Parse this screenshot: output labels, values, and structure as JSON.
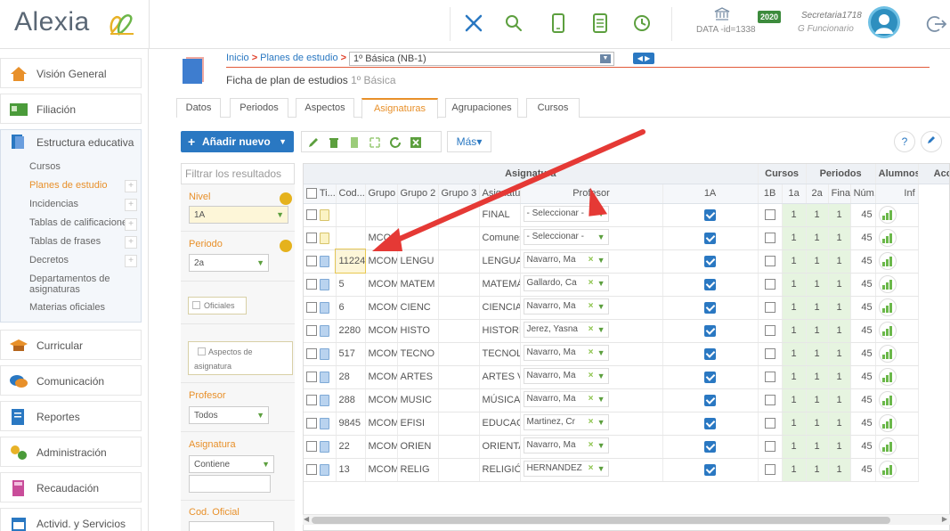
{
  "app": {
    "name": "Alexia"
  },
  "topbar": {
    "data_label": "DATA -id=1338",
    "year": "2020",
    "user_name": "Secretaria1718",
    "user_role": "Funcionario"
  },
  "sidebar": {
    "items": [
      {
        "label": "Visión General",
        "icon": "home-icon"
      },
      {
        "label": "Filiación",
        "icon": "id-card-icon"
      },
      {
        "label": "Estructura educativa",
        "icon": "books-icon"
      },
      {
        "label": "Curricular",
        "icon": "graduation-cap-icon"
      },
      {
        "label": "Comunicación",
        "icon": "chat-bubbles-icon"
      },
      {
        "label": "Reportes",
        "icon": "report-icon"
      },
      {
        "label": "Administración",
        "icon": "gears-icon"
      },
      {
        "label": "Recaudación",
        "icon": "calculator-icon"
      },
      {
        "label": "Activid. y Servicios",
        "icon": "calendar-icon"
      }
    ],
    "subitems": [
      {
        "label": "Cursos",
        "plus": false
      },
      {
        "label": "Planes de estudio",
        "plus": true
      },
      {
        "label": "Incidencias",
        "plus": true
      },
      {
        "label": "Tablas de calificaciones",
        "plus": true
      },
      {
        "label": "Tablas de frases",
        "plus": true
      },
      {
        "label": "Decretos",
        "plus": true
      },
      {
        "label": "Departamentos de asignaturas",
        "plus": false
      },
      {
        "label": "Materias oficiales",
        "plus": false
      }
    ],
    "plus_symbol": "+"
  },
  "breadcrumb": {
    "home": "Inicio",
    "sep": ">",
    "plans": "Planes de estudio",
    "selected": "1º Básica (NB-1)"
  },
  "page": {
    "title": "Ficha de plan de estudios",
    "subtitle": "1º Básica"
  },
  "tabs": [
    "Datos",
    "Periodos",
    "Aspectos",
    "Asignaturas",
    "Agrupaciones",
    "Cursos"
  ],
  "toolbar": {
    "add_label": "Añadir nuevo",
    "more_label": "Más",
    "help": "?"
  },
  "filter": {
    "search_placeholder": "Filtrar los resultados",
    "nivel_label": "Nivel",
    "nivel_value": "1A",
    "periodo_label": "Periodo",
    "periodo_value": "2a",
    "oficiales_label": "Oficiales",
    "aspectos_label": "Aspectos de asignatura",
    "profesor_label": "Profesor",
    "profesor_value": "Todos",
    "asignatura_label": "Asignatura",
    "asignatura_value": "Contiene",
    "codoficial_label": "Cod. Oficial"
  },
  "grid": {
    "group_headers": {
      "asignatura": "Asignatura",
      "cursos": "Cursos",
      "periodos": "Periodos",
      "alumnos": "Alumnos",
      "acciones": "Accio"
    },
    "columns": {
      "tipo": "Ti...",
      "cod": "Cod...",
      "grupo1": "Grupo 1",
      "grupo2": "Grupo 2",
      "grupo3": "Grupo 3",
      "asignatura": "Asignatura",
      "profesor": "Profesor",
      "c1a": "1A",
      "c1b": "1B",
      "p1a": "1a",
      "p2a": "2a",
      "final": "Final",
      "num": "Núm. d...",
      "inf": "Inf"
    },
    "rows": [
      {
        "type": "note",
        "cod": "",
        "g1": "",
        "g2": "",
        "asig": "FINAL",
        "prof": "- Seleccionar -",
        "x": false,
        "c1a": true,
        "p1": "1",
        "p2": "1",
        "fin": "1",
        "num": "45"
      },
      {
        "type": "note",
        "cod": "",
        "g1": "MCOM",
        "g2": "",
        "asig": "Comunes",
        "prof": "- Seleccionar -",
        "x": false,
        "c1a": true,
        "p1": "1",
        "p2": "1",
        "fin": "1",
        "num": "45"
      },
      {
        "type": "doc",
        "cod": "11224",
        "g1": "MCOM",
        "g2": "LENGU",
        "asig": "LENGUAJE Y COMUNICACI...",
        "prof": "Navarro, Ma",
        "x": true,
        "c1a": true,
        "p1": "1",
        "p2": "1",
        "fin": "1",
        "num": "45",
        "hl": true
      },
      {
        "type": "doc",
        "cod": "5",
        "g1": "MCOM",
        "g2": "MATEM",
        "asig": "MATEMÁTICA",
        "prof": "Gallardo, Ca",
        "x": true,
        "c1a": true,
        "p1": "1",
        "p2": "1",
        "fin": "1",
        "num": "45"
      },
      {
        "type": "doc",
        "cod": "6",
        "g1": "MCOM",
        "g2": "CIENC",
        "asig": "CIENCIAS NATURALES",
        "prof": "Navarro, Ma",
        "x": true,
        "c1a": true,
        "p1": "1",
        "p2": "1",
        "fin": "1",
        "num": "45"
      },
      {
        "type": "doc",
        "cod": "2280",
        "g1": "MCOM",
        "g2": "HISTO",
        "asig": "HISTORIA, GEOGRAFÍA Y C...",
        "prof": "Jerez, Yasna",
        "x": true,
        "c1a": true,
        "p1": "1",
        "p2": "1",
        "fin": "1",
        "num": "45"
      },
      {
        "type": "doc",
        "cod": "517",
        "g1": "MCOM",
        "g2": "TECNO",
        "asig": "TECNOLOGÍA",
        "prof": "Navarro, Ma",
        "x": true,
        "c1a": true,
        "p1": "1",
        "p2": "1",
        "fin": "1",
        "num": "45"
      },
      {
        "type": "doc",
        "cod": "28",
        "g1": "MCOM",
        "g2": "ARTES",
        "asig": "ARTES VISUALES",
        "prof": "Navarro, Ma",
        "x": true,
        "c1a": true,
        "p1": "1",
        "p2": "1",
        "fin": "1",
        "num": "45"
      },
      {
        "type": "doc",
        "cod": "288",
        "g1": "MCOM",
        "g2": "MUSIC",
        "asig": "MÚSICA",
        "prof": "Navarro, Ma",
        "x": true,
        "c1a": true,
        "p1": "1",
        "p2": "1",
        "fin": "1",
        "num": "45"
      },
      {
        "type": "doc",
        "cod": "9845",
        "g1": "MCOM",
        "g2": "EFISI",
        "asig": "EDUCACIÓN FÍSICA Y SAL...",
        "prof": "Martinez, Cr",
        "x": true,
        "c1a": true,
        "p1": "1",
        "p2": "1",
        "fin": "1",
        "num": "45"
      },
      {
        "type": "doc",
        "cod": "22",
        "g1": "MCOM",
        "g2": "ORIEN",
        "asig": "ORIENTACIÓN",
        "prof": "Navarro, Ma",
        "x": true,
        "c1a": true,
        "p1": "1",
        "p2": "1",
        "fin": "1",
        "num": "45"
      },
      {
        "type": "doc",
        "cod": "13",
        "g1": "MCOM",
        "g2": "RELIG",
        "asig": "RELIGIÓN",
        "prof": "HERNANDEZ",
        "x": true,
        "c1a": true,
        "p1": "1",
        "p2": "1",
        "fin": "1",
        "num": "45"
      }
    ]
  },
  "colors": {
    "accent": "#2a78c2",
    "orange": "#e8902a",
    "green": "#5c9f3e",
    "arrow": "#e53935"
  }
}
